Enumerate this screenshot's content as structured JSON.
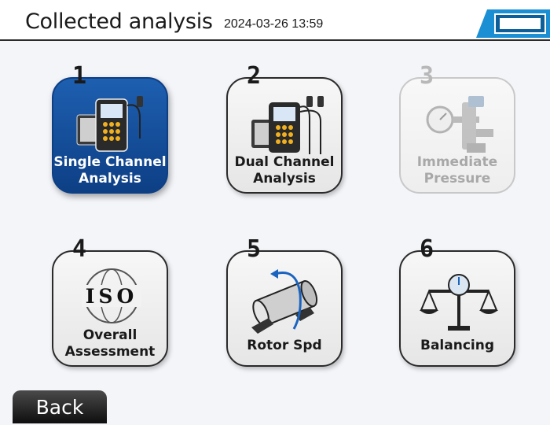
{
  "header": {
    "title": "Collected analysis",
    "datetime": "2024-03-26 13:59",
    "battery_icon": "battery-icon"
  },
  "tiles": [
    {
      "number": "1",
      "label_line1": "Single Channel",
      "label_line2": "Analysis",
      "icon": "single-channel-device-icon",
      "state": "selected"
    },
    {
      "number": "2",
      "label_line1": "Dual Channel",
      "label_line2": "Analysis",
      "icon": "dual-channel-device-icon",
      "state": "normal"
    },
    {
      "number": "3",
      "label_line1": "Immediate",
      "label_line2": "Pressure",
      "icon": "pressure-gauge-icon",
      "state": "disabled"
    },
    {
      "number": "4",
      "label_line1": "Overall",
      "label_line2": "Assessment",
      "icon": "iso-globe-icon",
      "iso_text": "ISO",
      "state": "normal"
    },
    {
      "number": "5",
      "label_line1": "Rotor Spd",
      "label_line2": "",
      "icon": "rotor-icon",
      "state": "normal"
    },
    {
      "number": "6",
      "label_line1": "Balancing",
      "label_line2": "",
      "icon": "balance-scale-icon",
      "state": "normal"
    }
  ],
  "footer": {
    "back_label": "Back"
  },
  "colors": {
    "selected_tile": "#1757a6",
    "battery_accent": "#1a8fd4"
  }
}
